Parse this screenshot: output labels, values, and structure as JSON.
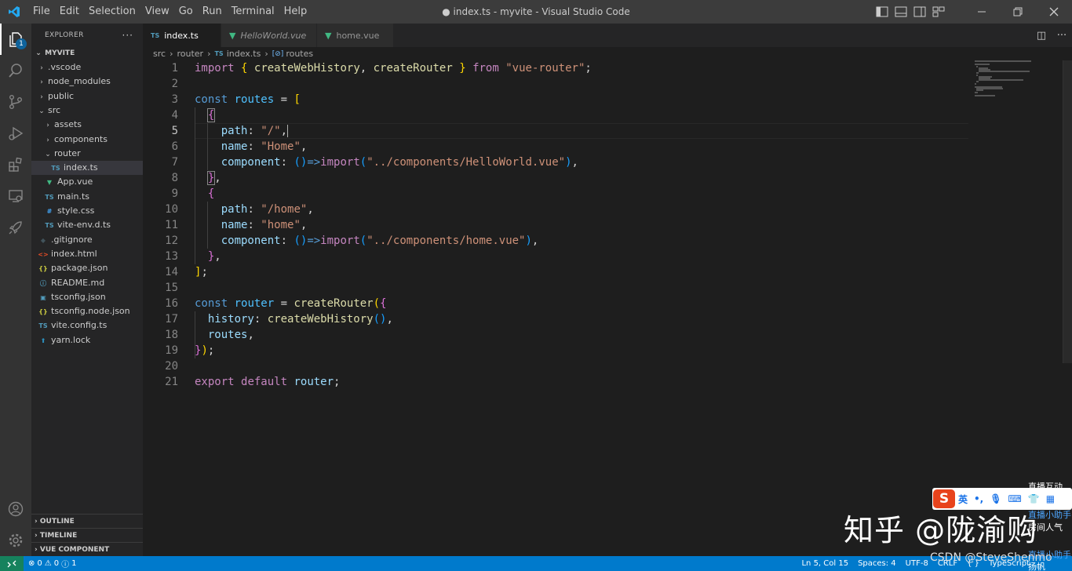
{
  "window": {
    "title": "● index.ts - myvite - Visual Studio Code"
  },
  "menu": [
    "File",
    "Edit",
    "Selection",
    "View",
    "Go",
    "Run",
    "Terminal",
    "Help"
  ],
  "activity": {
    "explorer_badge": "1"
  },
  "sidebar": {
    "header": "EXPLORER",
    "more": "···",
    "project": "MYVITE",
    "tree": [
      {
        "label": ".vscode",
        "kind": "folder",
        "depth": 0,
        "open": false
      },
      {
        "label": "node_modules",
        "kind": "folder",
        "depth": 0,
        "open": false
      },
      {
        "label": "public",
        "kind": "folder",
        "depth": 0,
        "open": false
      },
      {
        "label": "src",
        "kind": "folder",
        "depth": 0,
        "open": true
      },
      {
        "label": "assets",
        "kind": "folder",
        "depth": 1,
        "open": false
      },
      {
        "label": "components",
        "kind": "folder",
        "depth": 1,
        "open": false
      },
      {
        "label": "router",
        "kind": "folder",
        "depth": 1,
        "open": true
      },
      {
        "label": "index.ts",
        "kind": "ts",
        "depth": 2,
        "selected": true
      },
      {
        "label": "App.vue",
        "kind": "vue",
        "depth": 1
      },
      {
        "label": "main.ts",
        "kind": "ts",
        "depth": 1
      },
      {
        "label": "style.css",
        "kind": "css",
        "depth": 1
      },
      {
        "label": "vite-env.d.ts",
        "kind": "ts",
        "depth": 1
      },
      {
        "label": ".gitignore",
        "kind": "git",
        "depth": 0
      },
      {
        "label": "index.html",
        "kind": "html",
        "depth": 0
      },
      {
        "label": "package.json",
        "kind": "json",
        "depth": 0
      },
      {
        "label": "README.md",
        "kind": "md",
        "depth": 0
      },
      {
        "label": "tsconfig.json",
        "kind": "tsconfig",
        "depth": 0
      },
      {
        "label": "tsconfig.node.json",
        "kind": "json",
        "depth": 0
      },
      {
        "label": "vite.config.ts",
        "kind": "ts",
        "depth": 0
      },
      {
        "label": "yarn.lock",
        "kind": "lock",
        "depth": 0
      }
    ],
    "sections": [
      "OUTLINE",
      "TIMELINE",
      "VUE COMPONENT PREVIEW"
    ]
  },
  "tabs": [
    {
      "label": "index.ts",
      "type": "TS",
      "active": true,
      "dirty": true
    },
    {
      "label": "HelloWorld.vue",
      "type": "vue",
      "active": false
    },
    {
      "label": "home.vue",
      "type": "vue",
      "active": false
    }
  ],
  "breadcrumb": {
    "parts": [
      "src",
      "router",
      "index.ts",
      "routes"
    ],
    "file_icon": "TS",
    "symbol_icon": "[⊘]"
  },
  "editor": {
    "active_line": 5,
    "lines": [
      "import { createWebHistory, createRouter } from \"vue-router\";",
      "",
      "const routes = [",
      "  {",
      "    path: \"/\",",
      "    name: \"Home\",",
      "    component: ()=>import(\"../components/HelloWorld.vue\"),",
      "  },",
      "  {",
      "    path: \"/home\",",
      "    name: \"home\",",
      "    component: ()=>import(\"../components/home.vue\"),",
      "  },",
      "];",
      "",
      "const router = createRouter({",
      "  history: createWebHistory(),",
      "  routes,",
      "});",
      "",
      "export default router;"
    ]
  },
  "statusbar": {
    "errors": "0",
    "warnings": "0",
    "info": "1",
    "position": "Ln 5, Col 15",
    "spaces": "Spaces: 4",
    "encoding": "UTF-8",
    "eol": "CRLF",
    "braces": "{ }",
    "language": "TypeScript"
  },
  "overlay": {
    "watermark": "知乎 @陇渝购",
    "csdn": "CSDN @SteveShenmo",
    "ime_lang": "英",
    "side1": "直播互动",
    "side2": "直播小助手",
    "side3": "房间人气",
    "side4": "直播小助手",
    "side5": "扬帆"
  },
  "colors": {
    "accent": "#007acc",
    "remote": "#16825d",
    "titlebar": "#3c3c3c",
    "activitybar": "#333333",
    "sidebar": "#252526",
    "editor": "#1e1e1e"
  }
}
